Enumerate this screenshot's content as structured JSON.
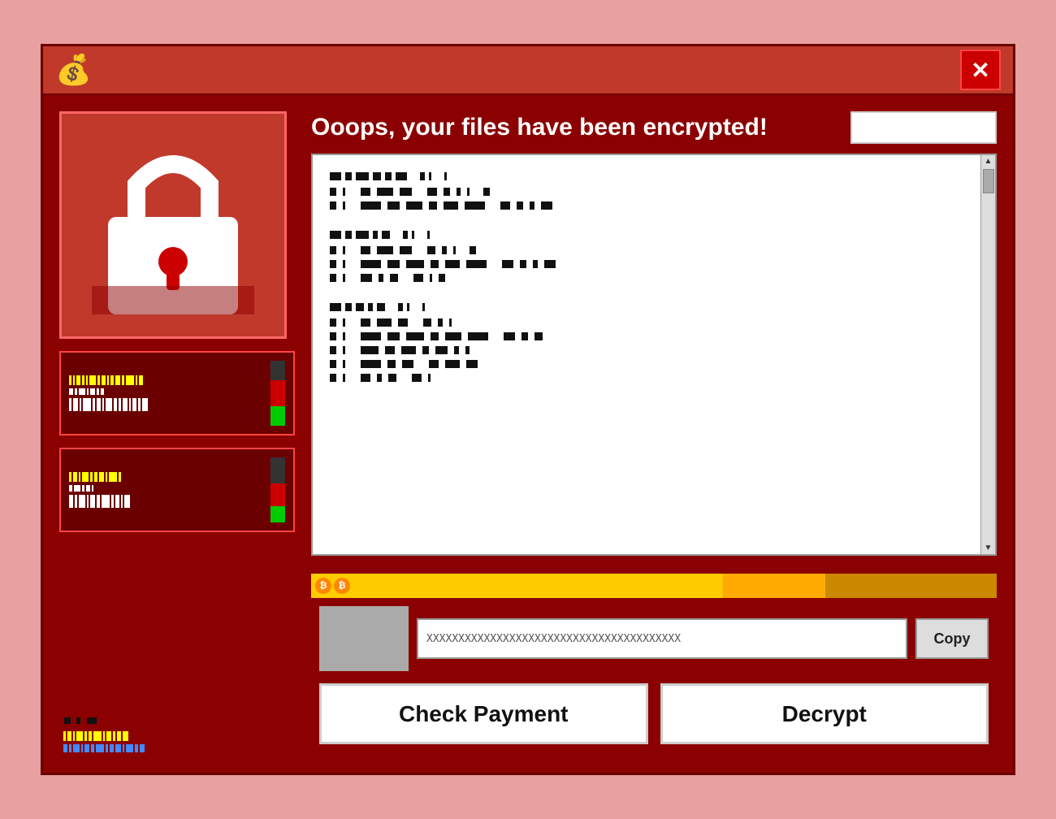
{
  "titlebar": {
    "icon": "💰",
    "close_label": "✕"
  },
  "header": {
    "title": "Ooops, your files have been encrypted!",
    "input_placeholder": ""
  },
  "text_area": {
    "sections": [
      {
        "id": "section1",
        "heading_bars": [
          14,
          8,
          3,
          12,
          3
        ],
        "lines": [
          [
            8,
            14,
            12,
            3,
            10
          ],
          [
            8,
            20,
            10,
            18,
            12,
            8,
            14
          ]
        ]
      },
      {
        "id": "section2",
        "heading_bars": [
          14,
          8,
          3,
          12,
          3
        ],
        "lines": [
          [
            8,
            14,
            12,
            3,
            10
          ],
          [
            8,
            20,
            10,
            18,
            12,
            8,
            14
          ],
          [
            8,
            12,
            6,
            14,
            3,
            10,
            6
          ]
        ]
      },
      {
        "id": "section3",
        "heading_bars": [
          14,
          8,
          3,
          12,
          3
        ],
        "lines": [
          [
            8,
            14,
            12,
            3,
            10
          ],
          [
            8,
            20,
            10,
            18,
            12,
            8,
            14
          ],
          [
            8,
            20,
            10,
            18,
            12,
            8,
            6,
            5
          ],
          [
            8,
            20,
            10,
            18,
            12,
            8,
            14
          ],
          [
            8,
            12,
            6,
            14,
            3,
            10
          ]
        ]
      }
    ]
  },
  "bottom": {
    "bitcoin_address": "XXXXXXXXXXXXXXXXXXXXXXXXXXXXXXXXXXXXXXXX",
    "copy_label": "Copy",
    "check_payment_label": "Check Payment",
    "decrypt_label": "Decrypt"
  }
}
